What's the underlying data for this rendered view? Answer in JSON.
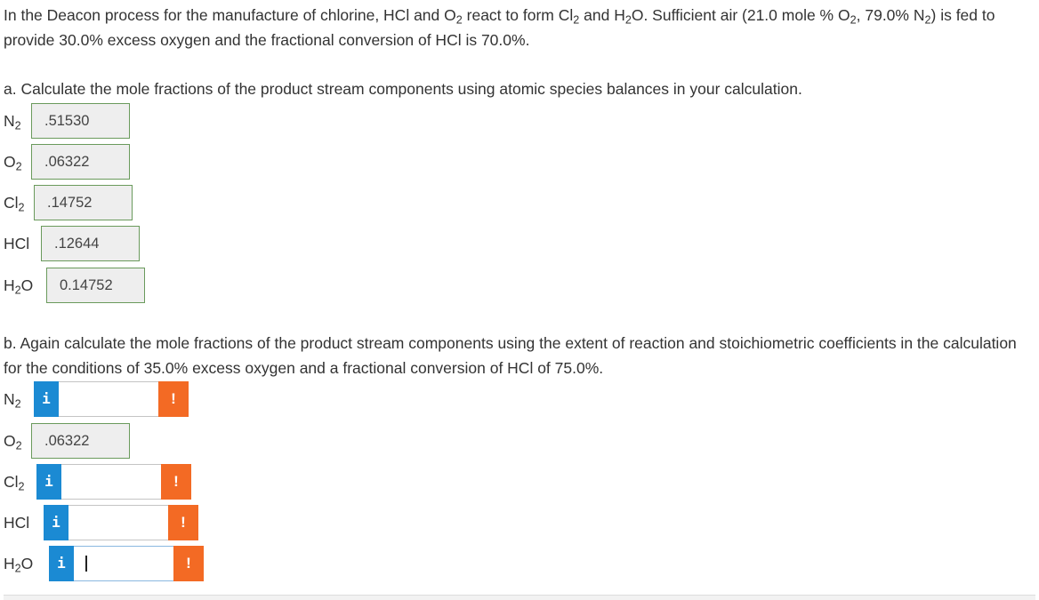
{
  "problem": {
    "intro": {
      "t1": "In the Deacon process for the manufacture of chlorine, HCl and O",
      "t1sub": "2",
      "t2": " react to form Cl",
      "t2sub": "2",
      "t3": " and H",
      "t3sub": "2",
      "t4": "O. Sufficient air (21.0 mole % O",
      "t4sub": "2",
      "t5": ", 79.0% N",
      "t5sub": "2",
      "t6": ") is fed to provide 30.0% excess oxygen and the fractional conversion of HCl is 70.0%."
    },
    "part_a": {
      "prompt": "a. Calculate the mole fractions of the product stream components using atomic species balances in your calculation.",
      "rows": [
        {
          "label": "N",
          "sub": "2",
          "tail": "",
          "value": ".51530"
        },
        {
          "label": "O",
          "sub": "2",
          "tail": "",
          "value": ".06322"
        },
        {
          "label": "Cl",
          "sub": "2",
          "tail": "",
          "value": ".14752"
        },
        {
          "label": "HCl",
          "sub": "",
          "tail": "",
          "value": ".12644"
        },
        {
          "label": "H",
          "sub": "2",
          "tail": "O",
          "value": "0.14752"
        }
      ]
    },
    "part_b": {
      "prompt": "b. Again calculate the mole fractions of the product stream components using the extent of reaction and stoichiometric coefficients in the calculation for the conditions of 35.0% excess oxygen and a fractional conversion of HCl of 75.0%.",
      "rows": [
        {
          "label": "N",
          "sub": "2",
          "tail": "",
          "value": ""
        },
        {
          "label": "O",
          "sub": "2",
          "tail": "",
          "value": ".06322"
        },
        {
          "label": "Cl",
          "sub": "2",
          "tail": "",
          "value": ""
        },
        {
          "label": "HCl",
          "sub": "",
          "tail": "",
          "value": ""
        },
        {
          "label": "H",
          "sub": "2",
          "tail": "O",
          "value": ""
        }
      ]
    },
    "icons": {
      "info": "i",
      "warning": "!"
    },
    "colors": {
      "info": "#1b8ad3",
      "warning": "#f36a24",
      "correct_border": "#6a9a5c"
    }
  }
}
